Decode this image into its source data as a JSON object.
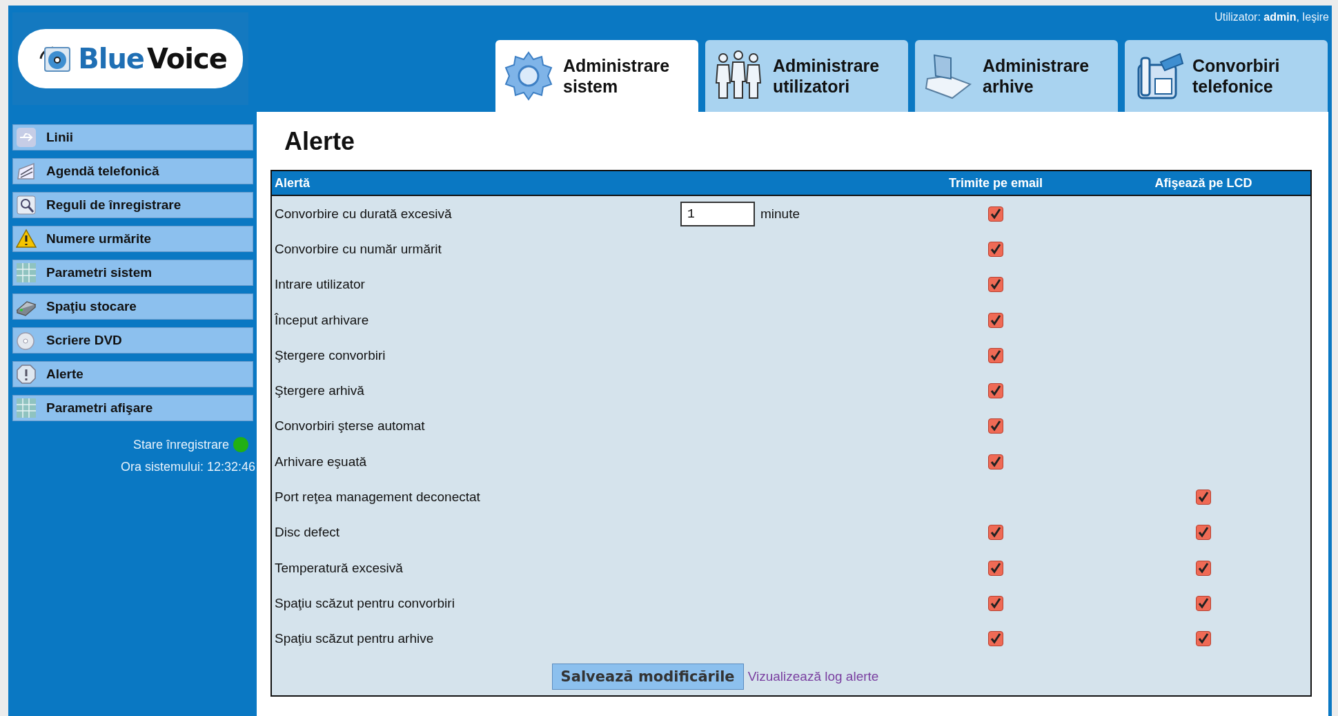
{
  "logo": {
    "part_1": "Blue",
    "part_2": "Voice"
  },
  "user_bar": {
    "label": "Utilizator: **admin**,",
    "logout": "Ieşire"
  },
  "tabs": [
    {
      "line_1": "Administrare",
      "line_2": "sistem",
      "selected": true
    },
    {
      "line_1": "Administrare",
      "line_2": "utilizatori",
      "selected": false
    },
    {
      "line_1": "Administrare",
      "line_2": "arhive",
      "selected": false
    },
    {
      "line_1": "Convorbiri",
      "line_2": "telefonice",
      "selected": false
    }
  ],
  "sidebar": {
    "items": [
      {
        "label": "Linii"
      },
      {
        "label": "Agendă telefonică"
      },
      {
        "label": "Reguli de înregistrare"
      },
      {
        "label": "Numere urmărite"
      },
      {
        "label": "Parametri sistem"
      },
      {
        "label": "Spaţiu stocare"
      },
      {
        "label": "Scriere DVD"
      },
      {
        "label": "Alerte"
      },
      {
        "label": "Parametri afişare"
      }
    ],
    "status": {
      "label": "Stare înregistrare",
      "color": "#22b014"
    },
    "clock": "Ora sistemului: 12:32:46"
  },
  "page_title": "Alerte",
  "table": {
    "columns": [
      "Alertă",
      "Trimite pe email",
      "Afişează pe LCD"
    ],
    "rows": [
      {
        "alert": "Convorbire cu durată excesivă",
        "input": {
          "value": "1",
          "unit": "minute"
        },
        "email": true
      },
      {
        "alert": "Convorbire cu număr urmărit",
        "email": true
      },
      {
        "alert": "Intrare utilizator",
        "email": true
      },
      {
        "alert": "Început arhivare",
        "email": true
      },
      {
        "alert": "Ştergere convorbiri",
        "email": true
      },
      {
        "alert": "Ştergere arhivă",
        "email": true
      },
      {
        "alert": "Convorbiri şterse automat",
        "email": true
      },
      {
        "alert": "Arhivare eşuată",
        "email": true
      },
      {
        "alert": "Port reţea management deconectat",
        "lcd": true
      },
      {
        "alert": "Disc defect",
        "email": true,
        "lcd": true
      },
      {
        "alert": "Temperatură excesivă",
        "email": true,
        "lcd": true
      },
      {
        "alert": "Spaţiu scăzut pentru convorbiri",
        "email": true,
        "lcd": true
      },
      {
        "alert": "Spaţiu scăzut pentru arhive",
        "email": true,
        "lcd": true
      }
    ],
    "save_button": "Salvează modificările",
    "log_link": "Vizualizează log alerte"
  }
}
